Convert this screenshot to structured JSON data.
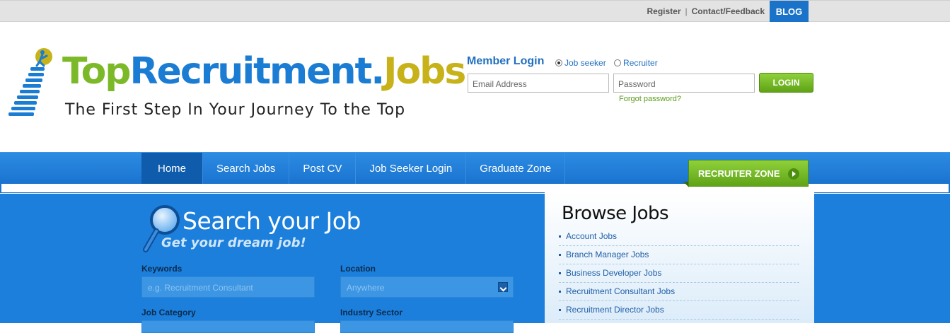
{
  "topbar": {
    "register_label": "Register",
    "separator": "|",
    "contact_label": "Contact/Feedback",
    "blog_label": "BLOG"
  },
  "logo": {
    "word_top": "Top",
    "word_recruitment": "Recruitment",
    "word_dot": ".",
    "word_jobs": "Jobs",
    "tagline": "The First Step In Your Journey To the Top",
    "colors": {
      "green": "#7cb928",
      "blue": "#1a7cd3",
      "gold": "#c7b21a"
    }
  },
  "login": {
    "title": "Member Login",
    "options": [
      {
        "label": "Job seeker",
        "selected": true
      },
      {
        "label": "Recruiter",
        "selected": false
      }
    ],
    "email_placeholder": "Email Address",
    "password_placeholder": "Password",
    "button_label": "LOGIN",
    "forgot_label": "Forgot password?"
  },
  "nav": {
    "items": [
      {
        "label": "Home",
        "active": true
      },
      {
        "label": "Search Jobs",
        "active": false
      },
      {
        "label": "Post CV",
        "active": false
      },
      {
        "label": "Job Seeker Login",
        "active": false
      },
      {
        "label": "Graduate Zone",
        "active": false
      }
    ],
    "recruiter_zone_label": "RECRUITER ZONE"
  },
  "search": {
    "title": "Search your Job",
    "subtitle": "Get your dream job!",
    "keywords_label": "Keywords",
    "keywords_placeholder": "e.g. Recruitment Consultant",
    "location_label": "Location",
    "location_value": "Anywhere",
    "category_label": "Job Category",
    "industry_label": "Industry Sector"
  },
  "browse": {
    "title": "Browse Jobs",
    "items": [
      "Account Jobs",
      "Branch Manager Jobs",
      "Business Developer Jobs",
      "Recruitment Consultant Jobs",
      "Recruitment Director Jobs"
    ]
  }
}
